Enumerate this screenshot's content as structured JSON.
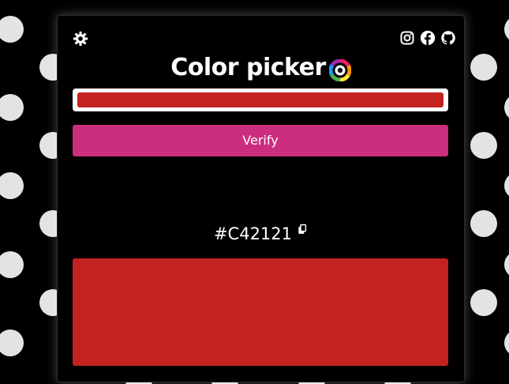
{
  "app": {
    "title": "Color picker"
  },
  "colors": {
    "page_background": "#000000",
    "dots": "#e3e3e3",
    "selected": "#C42121",
    "verify_button": "#cb2e7f",
    "text": "#ffffff"
  },
  "icons": {
    "settings": "gear-icon",
    "social": [
      "instagram-icon",
      "facebook-icon",
      "github-icon"
    ],
    "title": "color-wheel-icon",
    "copy": "copy-icon"
  },
  "form": {
    "verify_label": "Verify"
  },
  "result": {
    "hex": "#C42121"
  }
}
